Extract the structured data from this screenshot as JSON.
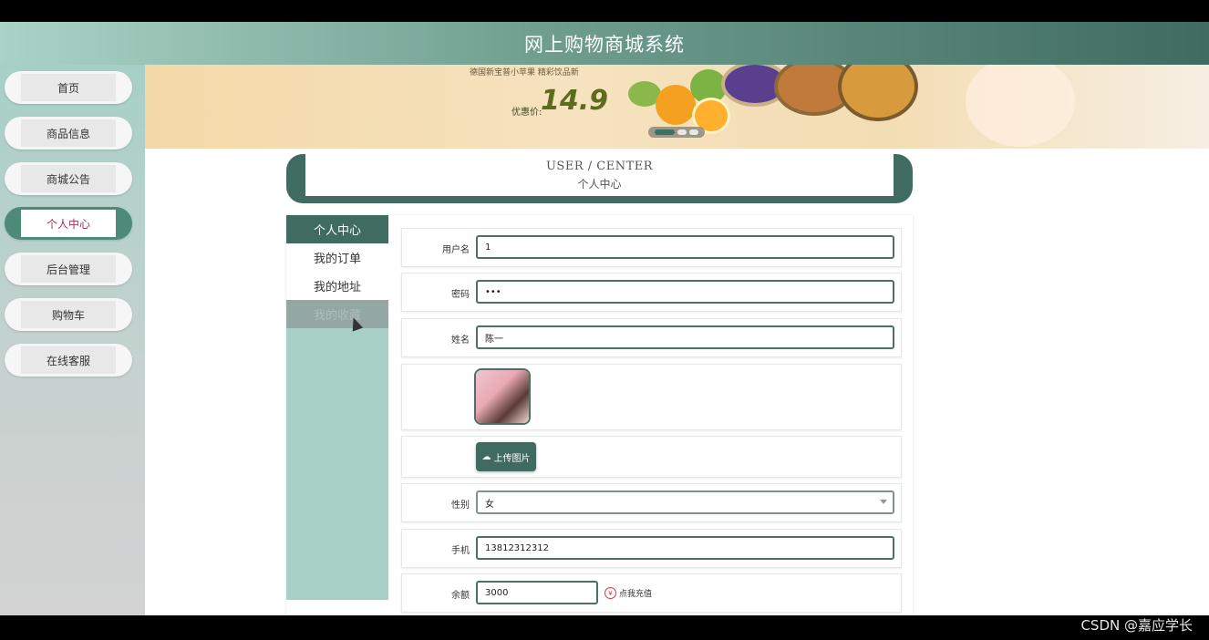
{
  "header": {
    "title": "网上购物商城系统"
  },
  "sidebar": {
    "items": [
      {
        "label": "首页"
      },
      {
        "label": "商品信息"
      },
      {
        "label": "商城公告"
      },
      {
        "label": "个人中心",
        "active": true
      },
      {
        "label": "后台管理"
      },
      {
        "label": "购物车"
      },
      {
        "label": "在线客服"
      }
    ]
  },
  "banner": {
    "tagline": "德国新宝普小苹果 精彩饮品新",
    "price_label": "优惠价:",
    "price": "14.9",
    "slide_count": 3,
    "active_slide": 1
  },
  "user_center": {
    "title_en": "USER / CENTER",
    "title_cn": "个人中心"
  },
  "submenu": {
    "items": [
      {
        "label": "个人中心",
        "state": "active"
      },
      {
        "label": "我的订单"
      },
      {
        "label": "我的地址"
      },
      {
        "label": "我的收藏",
        "state": "hover"
      }
    ]
  },
  "form": {
    "username": {
      "label": "用户名",
      "value": "1"
    },
    "password": {
      "label": "密码",
      "value": "•••"
    },
    "name": {
      "label": "姓名",
      "value": "陈一"
    },
    "upload": {
      "label": "上传图片",
      "icon": "cloud-upload-icon"
    },
    "gender": {
      "label": "性别",
      "value": "女"
    },
    "phone": {
      "label": "手机",
      "value": "13812312312"
    },
    "balance": {
      "label": "余额",
      "value": "3000",
      "recharge_label": "点我充值",
      "recharge_icon": "yen-circle-icon"
    }
  },
  "watermark": "CSDN @嘉应学长",
  "colors": {
    "primary": "#3f6b60",
    "sidebar_top": "#a6d0c6",
    "accent": "#a0325a"
  }
}
